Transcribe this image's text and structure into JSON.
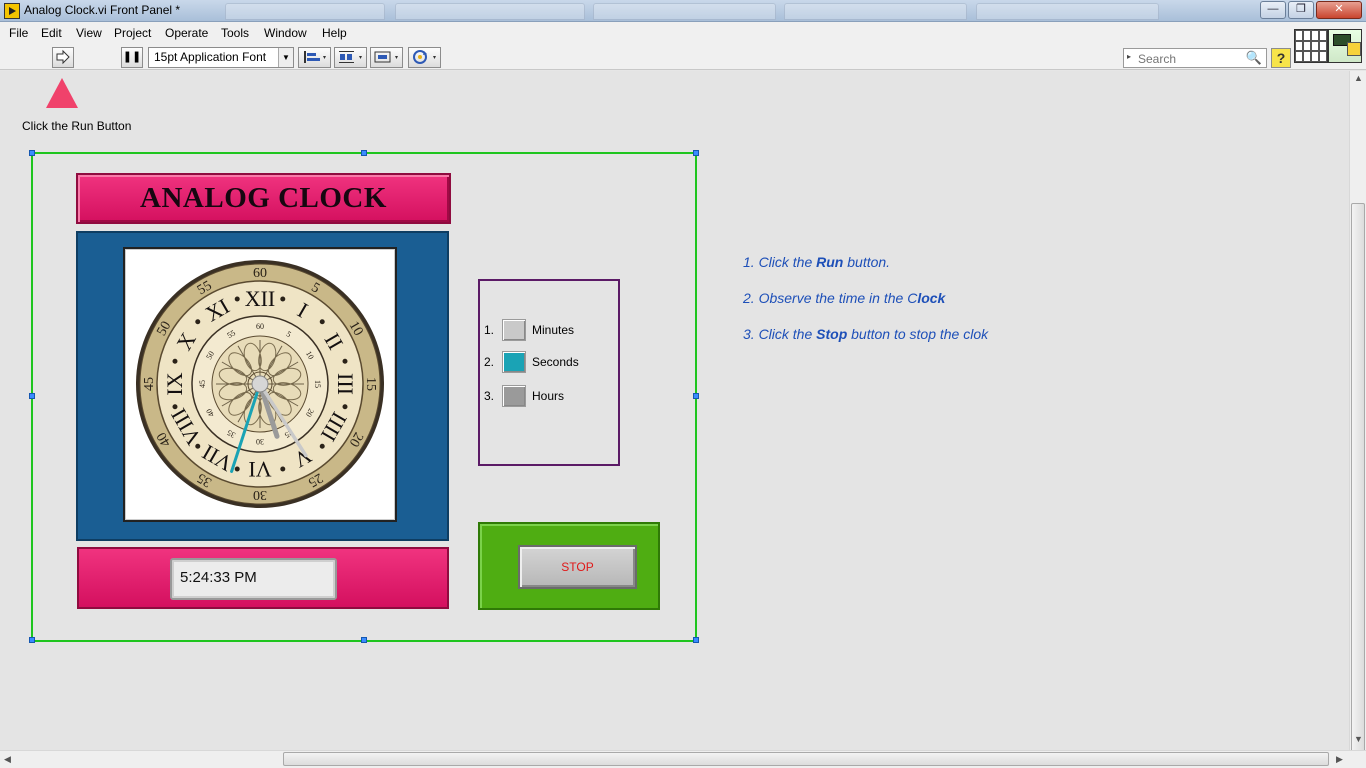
{
  "window": {
    "title": "Analog Clock.vi Front Panel *",
    "minimize": "—",
    "maximize": "❐",
    "close": "✕"
  },
  "menu": [
    "File",
    "Edit",
    "View",
    "Project",
    "Operate",
    "Tools",
    "Window",
    "Help"
  ],
  "toolbar": {
    "run_icon": "run-arrow-icon",
    "pause_label": "❚❚",
    "font_select": "15pt Application Font",
    "search_placeholder": "Search",
    "help_label": "?"
  },
  "panel": {
    "hint_label": "Click the Run Button",
    "clock_title": "ANALOG CLOCK",
    "time_value": "5:24:33 PM",
    "stop_label": "STOP"
  },
  "clock_face": {
    "outer_ticks": [
      "60",
      "5",
      "10",
      "15",
      "20",
      "25",
      "30",
      "35",
      "40",
      "45",
      "50",
      "55"
    ],
    "roman": [
      "XII",
      "I",
      "II",
      "III",
      "IIII",
      "V",
      "VI",
      "VII",
      "VIII",
      "IX",
      "X",
      "XI"
    ],
    "inner_ticks": [
      "60",
      "5",
      "10",
      "15",
      "20",
      "25",
      "30",
      "35",
      "40",
      "45",
      "50",
      "55"
    ],
    "hour": 5,
    "minute": 24,
    "second": 33
  },
  "legend": {
    "items": [
      {
        "num": "1.",
        "label": "Minutes",
        "color": "#c9c9c9"
      },
      {
        "num": "2.",
        "label": "Seconds",
        "color": "#1aa3b5"
      },
      {
        "num": "3.",
        "label": "Hours",
        "color": "#9a9a9a"
      }
    ]
  },
  "instructions": {
    "line1_a": "1. Click the ",
    "line1_b": "Run",
    "line1_c": " button.",
    "line2_a": "2. Observe the time in the C",
    "line2_b": "lock",
    "line3_a": "3. Click the ",
    "line3_b": "Stop",
    "line3_c": " button to stop the clok"
  },
  "colors": {
    "banner": "#e01870",
    "clock_frame": "#1a5e93",
    "stop_panel": "#4fad12",
    "selection": "#1ec51e",
    "instruction_text": "#1d4fb8"
  }
}
